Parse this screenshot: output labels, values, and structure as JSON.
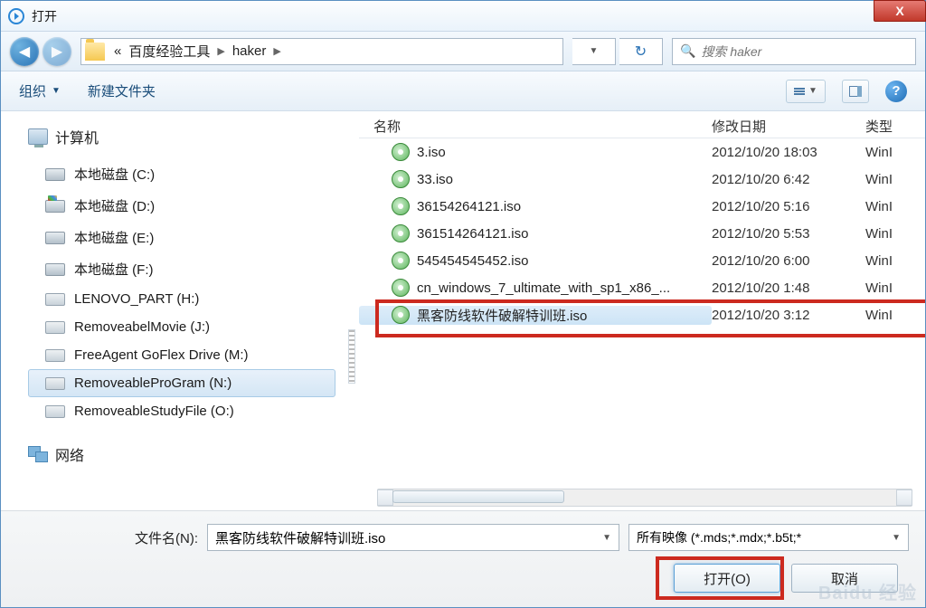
{
  "title": "打开",
  "close_x": "X",
  "breadcrumb": {
    "sep_left": "«",
    "part1": "百度经验工具",
    "part2": "haker"
  },
  "search": {
    "placeholder": "搜索 haker"
  },
  "toolbar": {
    "organize": "组织",
    "new_folder": "新建文件夹"
  },
  "sidebar": {
    "computer": "计算机",
    "items": [
      {
        "label": "本地磁盘 (C:)",
        "icon": "drive"
      },
      {
        "label": "本地磁盘 (D:)",
        "icon": "drive-win"
      },
      {
        "label": "本地磁盘 (E:)",
        "icon": "drive"
      },
      {
        "label": "本地磁盘 (F:)",
        "icon": "drive"
      },
      {
        "label": "LENOVO_PART (H:)",
        "icon": "usb"
      },
      {
        "label": "RemoveabelMovie (J:)",
        "icon": "usb"
      },
      {
        "label": "FreeAgent GoFlex Drive (M:)",
        "icon": "usb"
      },
      {
        "label": "RemoveableProGram (N:)",
        "icon": "usb",
        "selected": true
      },
      {
        "label": "RemoveableStudyFile (O:)",
        "icon": "usb"
      }
    ],
    "network": "网络"
  },
  "columns": {
    "name": "名称",
    "date": "修改日期",
    "type": "类型"
  },
  "files": [
    {
      "name": "3.iso",
      "date": "2012/10/20 18:03",
      "type": "WinI"
    },
    {
      "name": "33.iso",
      "date": "2012/10/20 6:42",
      "type": "WinI"
    },
    {
      "name": "36154264121.iso",
      "date": "2012/10/20 5:16",
      "type": "WinI"
    },
    {
      "name": "361514264121.iso",
      "date": "2012/10/20 5:53",
      "type": "WinI"
    },
    {
      "name": "545454545452.iso",
      "date": "2012/10/20 6:00",
      "type": "WinI"
    },
    {
      "name": "cn_windows_7_ultimate_with_sp1_x86_...",
      "date": "2012/10/20 1:48",
      "type": "WinI"
    },
    {
      "name": "黑客防线软件破解特训班.iso",
      "date": "2012/10/20 3:12",
      "type": "WinI",
      "selected": true
    }
  ],
  "footer": {
    "filename_label": "文件名(N):",
    "filename_value": "黑客防线软件破解特训班.iso",
    "filter": "所有映像 (*.mds;*.mdx;*.b5t;*",
    "open": "打开(O)",
    "cancel": "取消"
  },
  "watermark": "Baidu 经验"
}
